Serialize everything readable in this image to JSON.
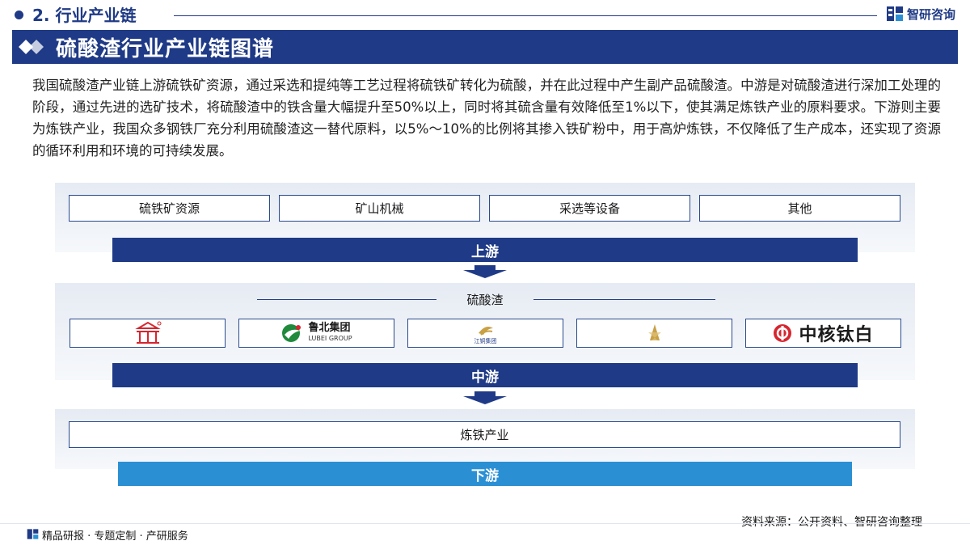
{
  "header": {
    "section_title": "2. 行业产业链",
    "brand_name": "智研咨询",
    "brand_icon": "zhiyan-logo-icon"
  },
  "title_bar": {
    "title": "硫酸渣行业产业链图谱"
  },
  "intro": "我国硫酸渣产业链上游硫铁矿资源，通过采选和提纯等工艺过程将硫铁矿转化为硫酸，并在此过程中产生副产品硫酸渣。中游是对硫酸渣进行深加工处理的阶段，通过先进的选矿技术，将硫酸渣中的铁含量大幅提升至50%以上，同时将其硫含量有效降低至1%以下，使其满足炼铁产业的原料要求。下游则主要为炼铁产业，我国众多钢铁厂充分利用硫酸渣这一替代原料，以5%～10%的比例将其掺入铁矿粉中，用于高炉炼铁，不仅降低了生产成本，还实现了资源的循环利用和环境的可持续发展。",
  "upstream": {
    "items": [
      "硫铁矿资源",
      "矿山机械",
      "采选等设备",
      "其他"
    ],
    "band_label": "上游"
  },
  "midstream": {
    "label": "硫酸渣",
    "band_label": "中游",
    "logos": [
      {
        "name": "company-logo-1",
        "text": ""
      },
      {
        "name": "lubei-group-logo",
        "text": "鲁北集团",
        "sub": "LUBEI GROUP"
      },
      {
        "name": "jiangtong-group-logo",
        "text": "",
        "sub": "江铜集团"
      },
      {
        "name": "company-logo-4",
        "text": ""
      },
      {
        "name": "zhonghe-taibai-logo",
        "text": "中核钛白"
      }
    ]
  },
  "downstream": {
    "item": "炼铁产业",
    "band_label": "下游"
  },
  "footer": {
    "source": "资料来源：公开资料、智研咨询整理",
    "tagline": "精品研报 · 专题定制 · 产研服务"
  },
  "colors": {
    "navy": "#1f3a86",
    "light_blue": "#2b8fd4",
    "panel": "#e6ebf3",
    "logo_red": "#d6262f",
    "logo_green": "#1f8a3c",
    "logo_gold": "#c8a046"
  }
}
